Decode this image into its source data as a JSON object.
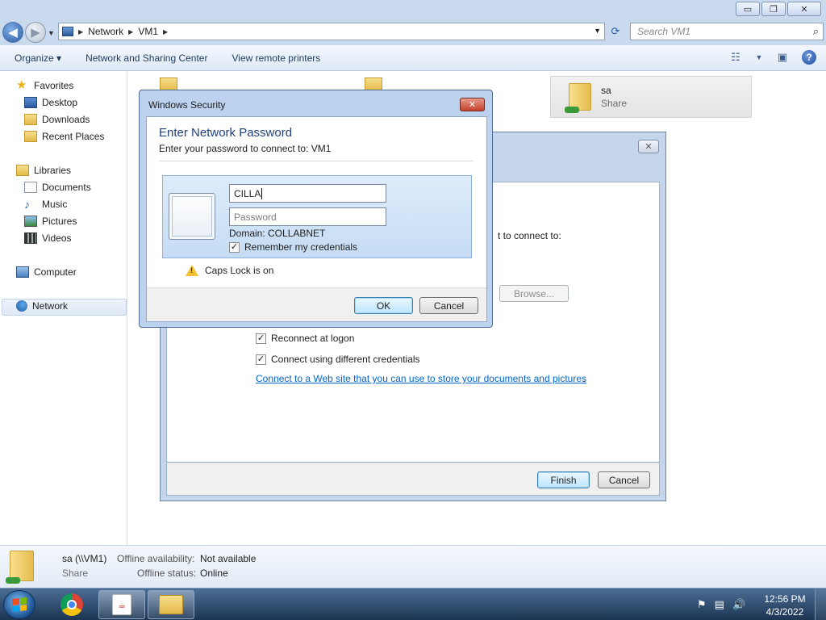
{
  "window": {
    "minimize": "▭",
    "restore": "❐",
    "close": "✕"
  },
  "address": {
    "crumbs": [
      "Network",
      "VM1"
    ],
    "search_placeholder": "Search VM1"
  },
  "toolbar": {
    "organize": "Organize ▾",
    "network_center": "Network and Sharing Center",
    "remote_printers": "View remote printers"
  },
  "sidebar": {
    "favorites": "Favorites",
    "desktop": "Desktop",
    "downloads": "Downloads",
    "recent": "Recent Places",
    "libraries": "Libraries",
    "documents": "Documents",
    "music": "Music",
    "pictures": "Pictures",
    "videos": "Videos",
    "computer": "Computer",
    "network": "Network"
  },
  "content": {
    "share_name": "sa",
    "share_type": "Share"
  },
  "map_dialog": {
    "connect_fragment": "t to connect to:",
    "browse": "Browse...",
    "reconnect": "Reconnect at logon",
    "different_creds": "Connect using different credentials",
    "web_link": "Connect to a Web site that you can use to store your documents and pictures",
    "web_link_period": ".",
    "finish": "Finish",
    "cancel": "Cancel"
  },
  "security_dialog": {
    "title": "Windows Security",
    "heading": "Enter Network Password",
    "subheading": "Enter your password to connect to: VM1",
    "username_value": "CILLA",
    "password_placeholder": "Password",
    "domain": "Domain: COLLABNET",
    "remember": "Remember my credentials",
    "remember_checked": true,
    "caps_warning": "Caps Lock is on",
    "ok": "OK",
    "cancel": "Cancel"
  },
  "details": {
    "name": "sa (\\\\VM1)",
    "kind": "Share",
    "offline_availability_label": "Offline availability:",
    "offline_availability_value": "Not available",
    "offline_status_label": "Offline status:",
    "offline_status_value": "Online"
  },
  "taskbar": {
    "time": "12:56 PM",
    "date": "4/3/2022"
  }
}
